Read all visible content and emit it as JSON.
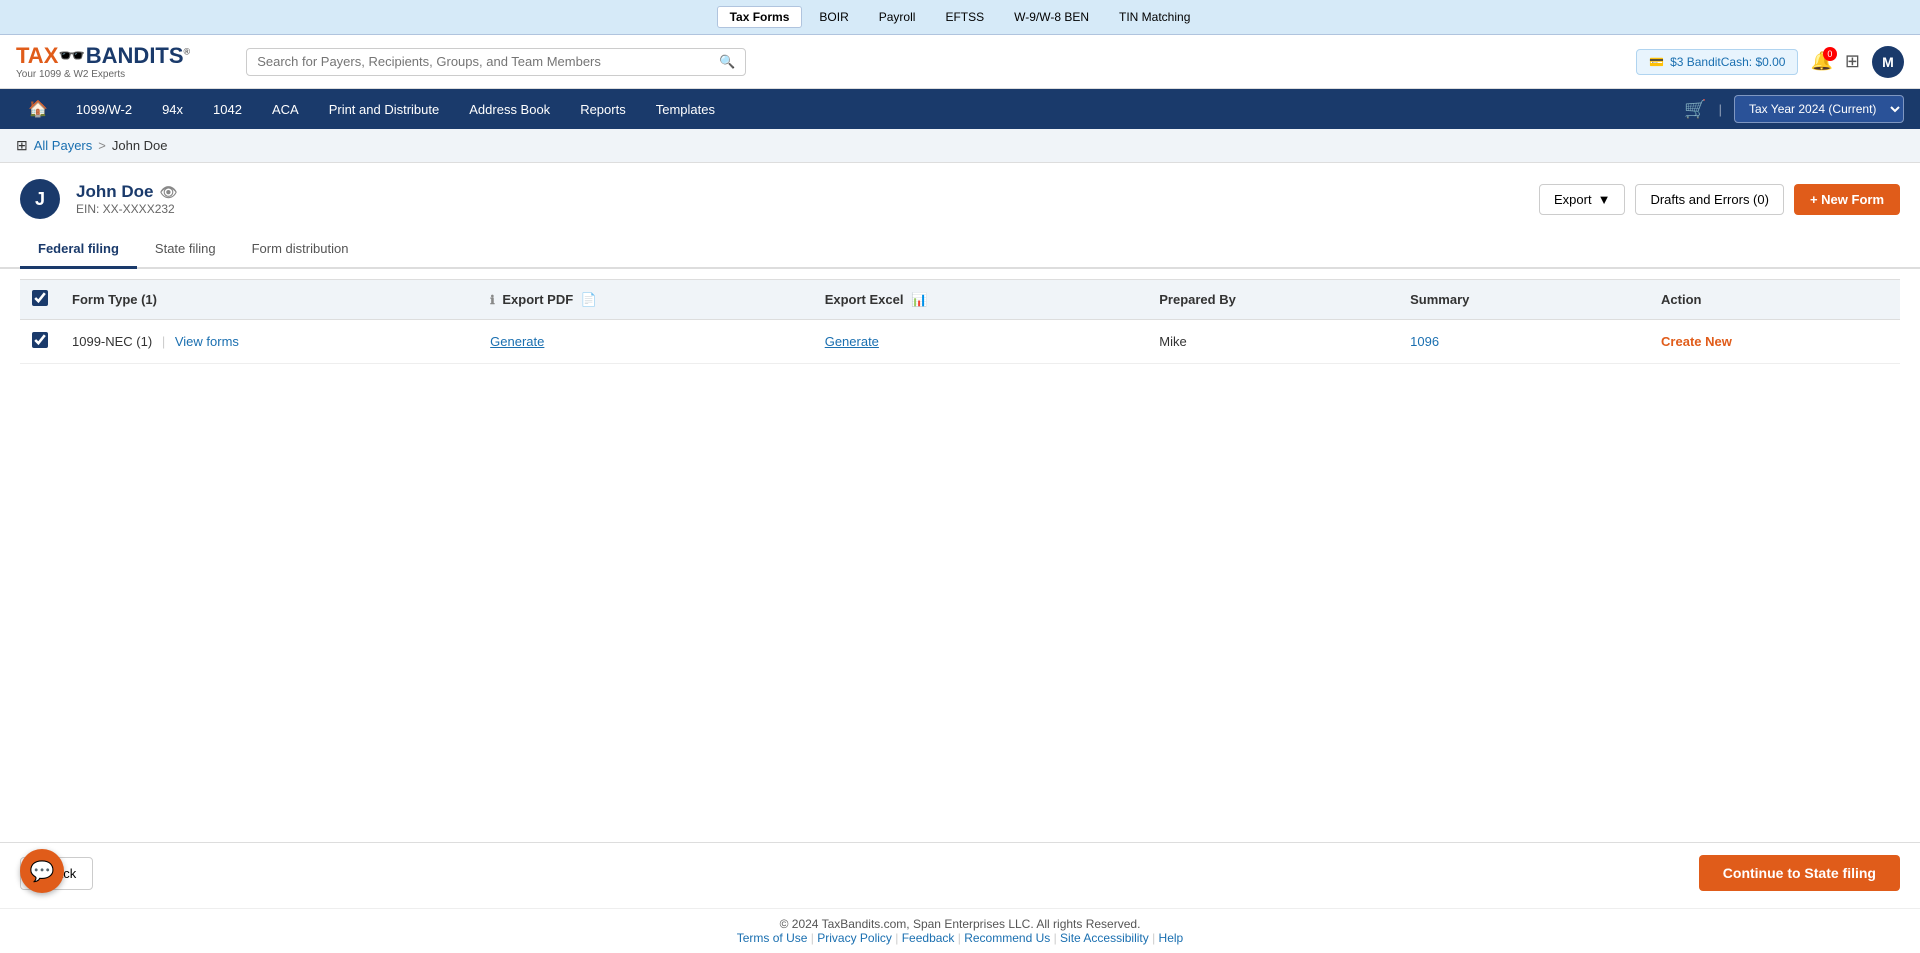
{
  "topNav": {
    "items": [
      {
        "label": "Tax Forms",
        "active": true
      },
      {
        "label": "BOIR",
        "active": false
      },
      {
        "label": "Payroll",
        "active": false
      },
      {
        "label": "EFTSS",
        "active": false
      },
      {
        "label": "W-9/W-8 BEN",
        "active": false
      },
      {
        "label": "TIN Matching",
        "active": false
      }
    ]
  },
  "header": {
    "logo": "TAXBANDITS",
    "logoSub": "Your 1099 & W2 Experts",
    "searchPlaceholder": "Search for Payers, Recipients, Groups, and Team Members",
    "banditCash": "$3 BanditCash: $0.00",
    "notifCount": "0",
    "avatarLabel": "M"
  },
  "mainNav": {
    "items": [
      {
        "label": "1099/W-2"
      },
      {
        "label": "94x"
      },
      {
        "label": "1042"
      },
      {
        "label": "ACA"
      },
      {
        "label": "Print and Distribute"
      },
      {
        "label": "Address Book"
      },
      {
        "label": "Reports"
      },
      {
        "label": "Templates"
      }
    ],
    "taxYear": "Tax Year 2024 (Current)"
  },
  "breadcrumb": {
    "allPayers": "All Payers",
    "separator": ">",
    "current": "John Doe"
  },
  "payer": {
    "avatarLabel": "J",
    "name": "John Doe",
    "ein": "EIN: XX-XXXX232",
    "exportLabel": "Export",
    "draftsLabel": "Drafts and Errors (0)",
    "newFormLabel": "+ New Form"
  },
  "tabs": [
    {
      "label": "Federal filing",
      "active": true
    },
    {
      "label": "State filing",
      "active": false
    },
    {
      "label": "Form distribution",
      "active": false
    }
  ],
  "table": {
    "columns": [
      {
        "label": "Form Type (1)",
        "key": "formType"
      },
      {
        "label": "Export PDF",
        "key": "exportPdf"
      },
      {
        "label": "Export Excel",
        "key": "exportExcel"
      },
      {
        "label": "Prepared By",
        "key": "preparedBy"
      },
      {
        "label": "Summary",
        "key": "summary"
      },
      {
        "label": "Action",
        "key": "action"
      }
    ],
    "rows": [
      {
        "formType": "1099-NEC (1)",
        "viewFormsLabel": "View forms",
        "exportPdf": "Generate",
        "exportExcel": "Generate",
        "preparedBy": "Mike",
        "summary": "1096",
        "action": "Create New"
      }
    ]
  },
  "bottomBar": {
    "backLabel": "Back",
    "continueLabel": "Continue to State filing"
  },
  "footer": {
    "copyright": "© 2024 TaxBandits.com, Span Enterprises LLC. All rights Reserved.",
    "links": [
      {
        "label": "Terms of Use"
      },
      {
        "label": "Privacy Policy"
      },
      {
        "label": "Feedback"
      },
      {
        "label": "Recommend Us"
      },
      {
        "label": "Site Accessibility"
      },
      {
        "label": "Help"
      }
    ]
  }
}
